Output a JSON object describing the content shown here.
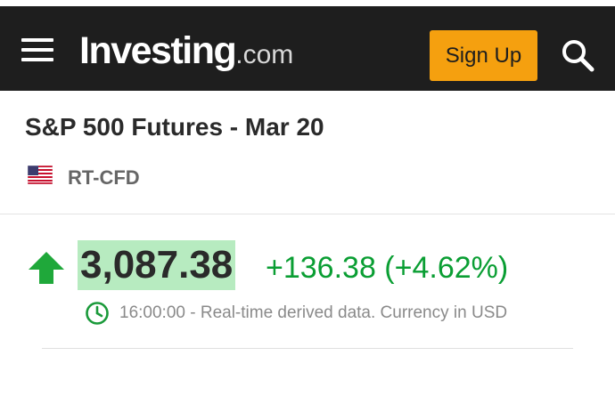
{
  "header": {
    "menu_icon": "hamburger-menu-icon",
    "logo_brand": "Investing",
    "logo_tld": ".com",
    "signup_label": "Sign Up",
    "search_icon": "search-icon",
    "background": "#1e1e1e",
    "accent": "#f5a00f"
  },
  "instrument": {
    "title": "S&P 500 Futures - Mar 20",
    "flag_icon": "us-flag-icon",
    "exchange": "RT-CFD"
  },
  "quote": {
    "direction_icon": "up-arrow-icon",
    "price": "3,087.38",
    "change": "+136.38 (+4.62%)",
    "change_color": "#0a9e33",
    "price_highlight": "#b7ebc0",
    "clock_icon": "clock-icon",
    "time_note": "16:00:00 - Real-time derived data. Currency in USD"
  }
}
